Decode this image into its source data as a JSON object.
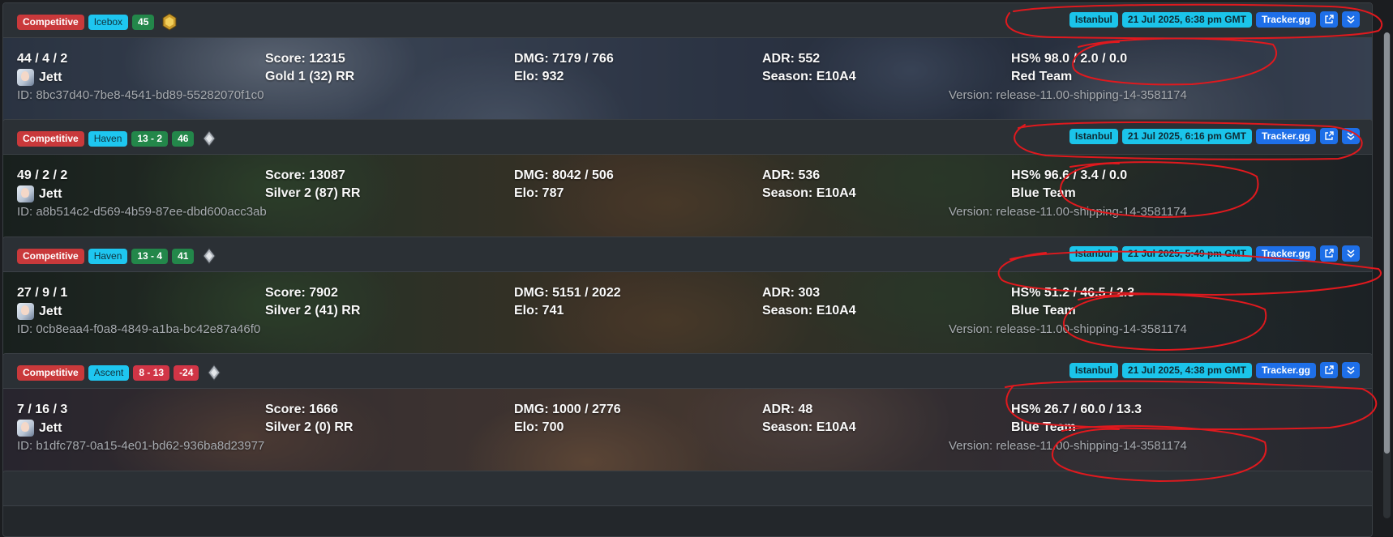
{
  "matches": [
    {
      "mode": "Competitive",
      "map": "Icebox",
      "score": "",
      "rr": "45",
      "rank_icon": "gold-rank-icon",
      "server": "Istanbul",
      "date": "21 Jul 2025, 6:38 pm GMT",
      "tracker": "Tracker.gg",
      "kda": "44 / 4 / 2",
      "agent": "Jett",
      "score_text": "Score: 12315",
      "rank_text": "Gold 1 (32) RR",
      "dmg": "DMG: 7179 / 766",
      "elo": "Elo: 932",
      "adr": "ADR: 552",
      "season": "Season: E10A4",
      "hs": "HS% 98.0 / 2.0 / 0.0",
      "team": "Red Team",
      "id": "ID: 8bc37d40-7be8-4541-bd89-55282070f1c0",
      "version": "Version: release-11.00-shipping-14-3581174"
    },
    {
      "mode": "Competitive",
      "map": "Haven",
      "score": "13 - 2",
      "rr": "46",
      "rank_icon": "silver-rank-icon",
      "server": "Istanbul",
      "date": "21 Jul 2025, 6:16 pm GMT",
      "tracker": "Tracker.gg",
      "kda": "49 / 2 / 2",
      "agent": "Jett",
      "score_text": "Score: 13087",
      "rank_text": "Silver 2 (87) RR",
      "dmg": "DMG: 8042 / 506",
      "elo": "Elo: 787",
      "adr": "ADR: 536",
      "season": "Season: E10A4",
      "hs": "HS% 96.6 / 3.4 / 0.0",
      "team": "Blue Team",
      "id": "ID: a8b514c2-d569-4b59-87ee-dbd600acc3ab",
      "version": "Version: release-11.00-shipping-14-3581174"
    },
    {
      "mode": "Competitive",
      "map": "Haven",
      "score": "13 - 4",
      "rr": "41",
      "rank_icon": "silver-rank-icon",
      "server": "Istanbul",
      "date": "21 Jul 2025, 5:49 pm GMT",
      "tracker": "Tracker.gg",
      "kda": "27 / 9 / 1",
      "agent": "Jett",
      "score_text": "Score: 7902",
      "rank_text": "Silver 2 (41) RR",
      "dmg": "DMG: 5151 / 2022",
      "elo": "Elo: 741",
      "adr": "ADR: 303",
      "season": "Season: E10A4",
      "hs": "HS% 51.2 / 46.5 / 2.3",
      "team": "Blue Team",
      "id": "ID: 0cb8eaa4-f0a8-4849-a1ba-bc42e87a46f0",
      "version": "Version: release-11.00-shipping-14-3581174"
    },
    {
      "mode": "Competitive",
      "map": "Ascent",
      "score": "8 - 13",
      "rr": "-24",
      "rank_icon": "silver-rank-icon",
      "server": "Istanbul",
      "date": "21 Jul 2025, 4:38 pm GMT",
      "tracker": "Tracker.gg",
      "kda": "7 / 16 / 3",
      "agent": "Jett",
      "score_text": "Score: 1666",
      "rank_text": "Silver 2 (0) RR",
      "dmg": "DMG: 1000 / 2776",
      "elo": "Elo: 700",
      "adr": "ADR: 48",
      "season": "Season: E10A4",
      "hs": "HS% 26.7 / 60.0 / 13.3",
      "team": "Blue Team",
      "id": "ID: b1dfc787-0a15-4e01-bd62-936ba8d23977",
      "version": "Version: release-11.00-shipping-14-3581174"
    }
  ],
  "colors": {
    "competitive": "#c9393b",
    "map_badge": "#1ec6f0",
    "win_badge": "#23874a",
    "loss_badge": "#d13546",
    "action_blue": "#1e6fe8",
    "annotation_red": "#e0191e"
  }
}
